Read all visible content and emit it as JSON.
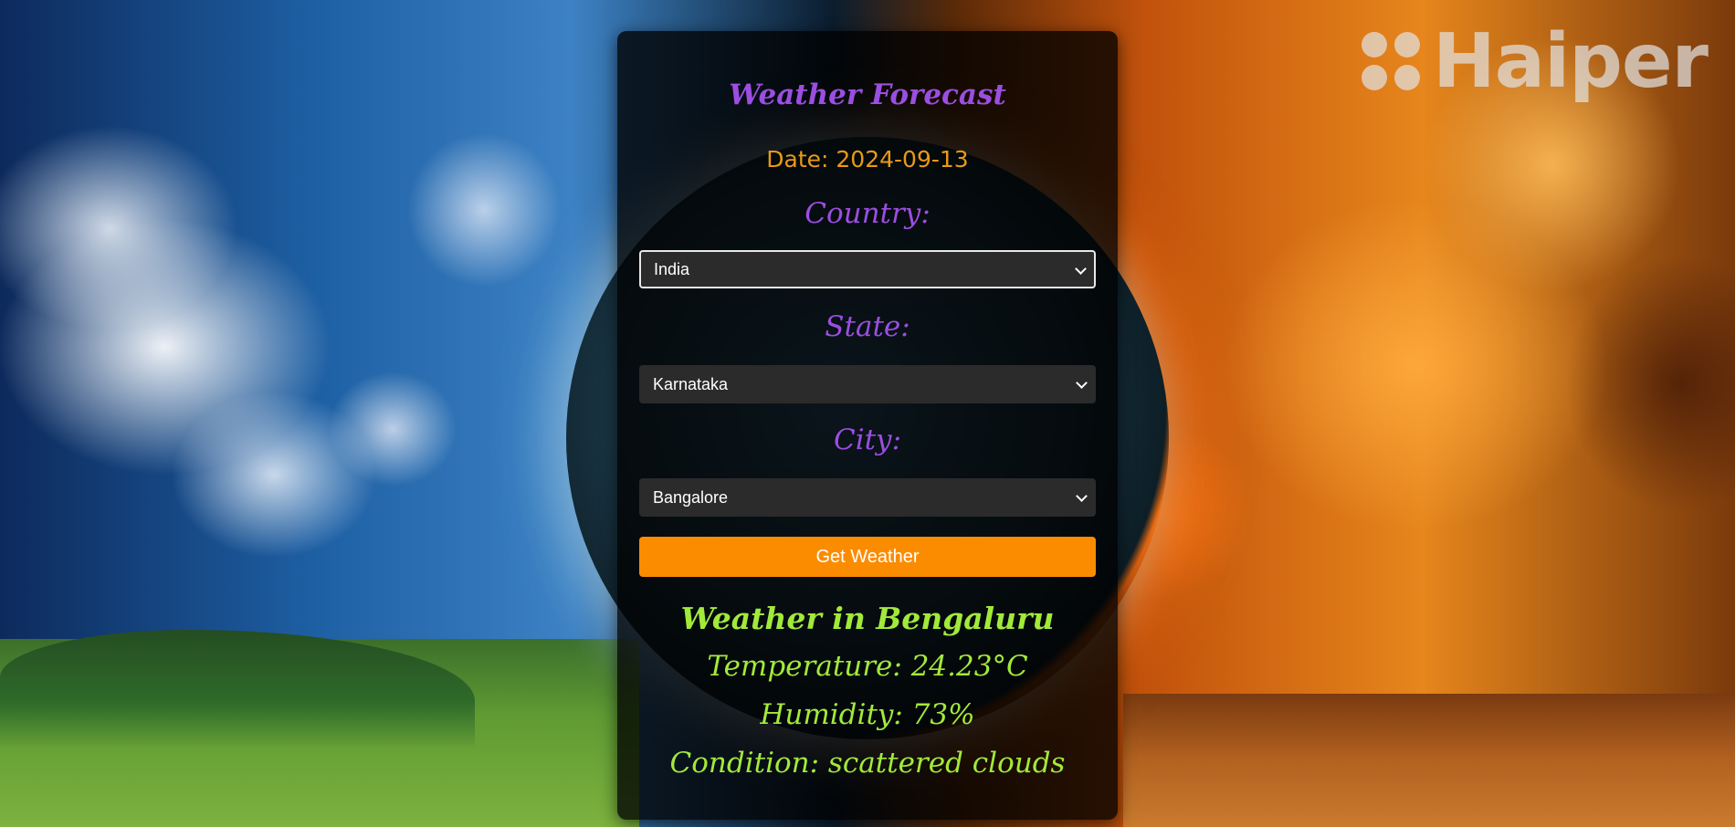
{
  "watermark": {
    "brand": "Haiper"
  },
  "app": {
    "title": "Weather Forecast",
    "date_text": "Date: 2024-09-13"
  },
  "form": {
    "country": {
      "label": "Country:",
      "selected": "India"
    },
    "state": {
      "label": "State:",
      "selected": "Karnataka"
    },
    "city": {
      "label": "City:",
      "selected": "Bangalore"
    },
    "submit_label": "Get Weather"
  },
  "result": {
    "heading": "Weather in Bengaluru",
    "temperature": "Temperature: 24.23°C",
    "humidity": "Humidity: 73%",
    "condition": "Condition: scattered clouds"
  },
  "icons": {
    "watermark_logo": "haiper-logo-icon",
    "select_caret": "chevron-down-icon"
  },
  "colors": {
    "heading_purple": "#9b4ee0",
    "date_orange": "#e89a16",
    "button_orange": "#fb8c00",
    "result_green": "#a2ea3a"
  }
}
